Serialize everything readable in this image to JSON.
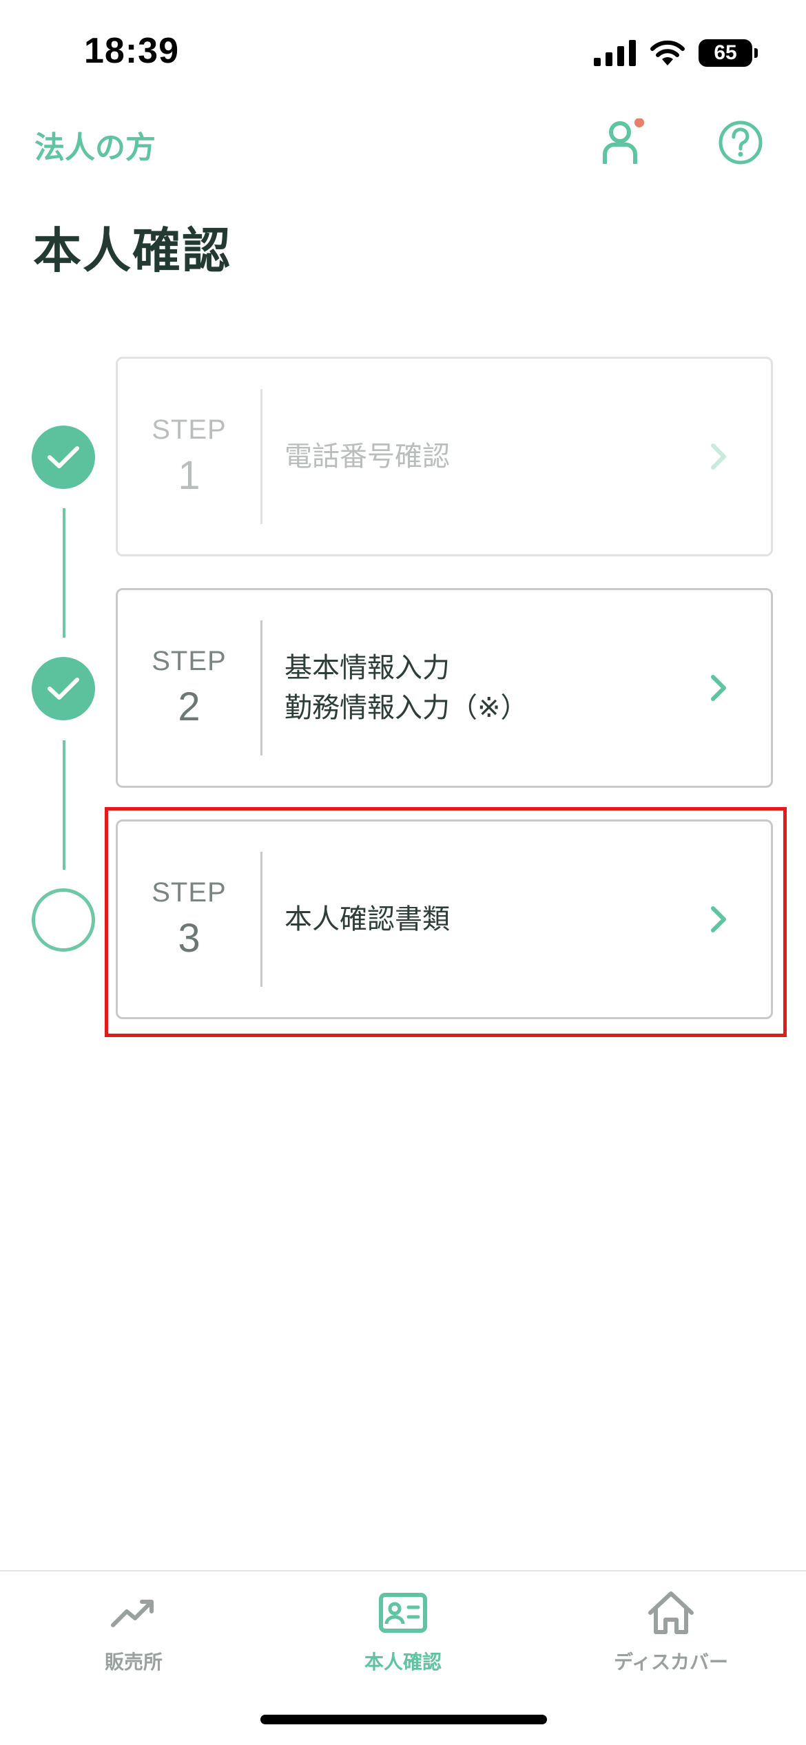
{
  "status_bar": {
    "time": "18:39",
    "battery": "65",
    "icons": [
      "signal-icon",
      "wifi-icon",
      "battery-icon"
    ]
  },
  "header": {
    "account_type": "法人の方",
    "user_icon": "user-icon",
    "help_icon": "help-icon",
    "notification_dot_color": "#e8806b"
  },
  "page": {
    "title": "本人確認"
  },
  "steps": [
    {
      "step_word": "STEP",
      "number": "1",
      "lines": [
        "電話番号確認"
      ],
      "status": "completed"
    },
    {
      "step_word": "STEP",
      "number": "2",
      "lines": [
        "基本情報入力",
        "勤務情報入力（※）"
      ],
      "status": "completed"
    },
    {
      "step_word": "STEP",
      "number": "3",
      "lines": [
        "本人確認書類"
      ],
      "status": "pending"
    }
  ],
  "tabbar": {
    "tabs": [
      {
        "label": "販売所",
        "icon": "trend-chart-icon",
        "active": false
      },
      {
        "label": "本人確認",
        "icon": "id-card-icon",
        "active": true
      },
      {
        "label": "ディスカバー",
        "icon": "home-icon",
        "active": false
      }
    ]
  },
  "colors": {
    "accent": "#5fc4a0",
    "title": "#223a31",
    "highlight": "#e21b1b",
    "inactive_tab": "#9aa09e"
  }
}
